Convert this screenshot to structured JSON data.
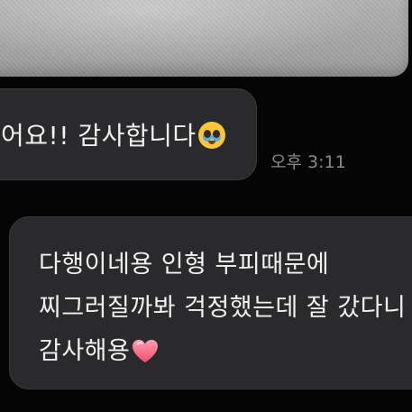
{
  "messages": [
    {
      "text": "어요!! 감사합니다",
      "emoji": "pleading-face-icon",
      "time": "오후 3:11"
    },
    {
      "lines": [
        "다행이네용 인형 부피때문에",
        "찌그러질까봐 걱정했는데 잘 갔다니",
        "감사해용"
      ],
      "emoji": "heart-icon"
    }
  ],
  "colors": {
    "background": "#050505",
    "bubble": "#2a2a2c",
    "text": "#f1f1f1",
    "timestamp": "#8a8a8d",
    "heart": "#ff6f8a"
  }
}
